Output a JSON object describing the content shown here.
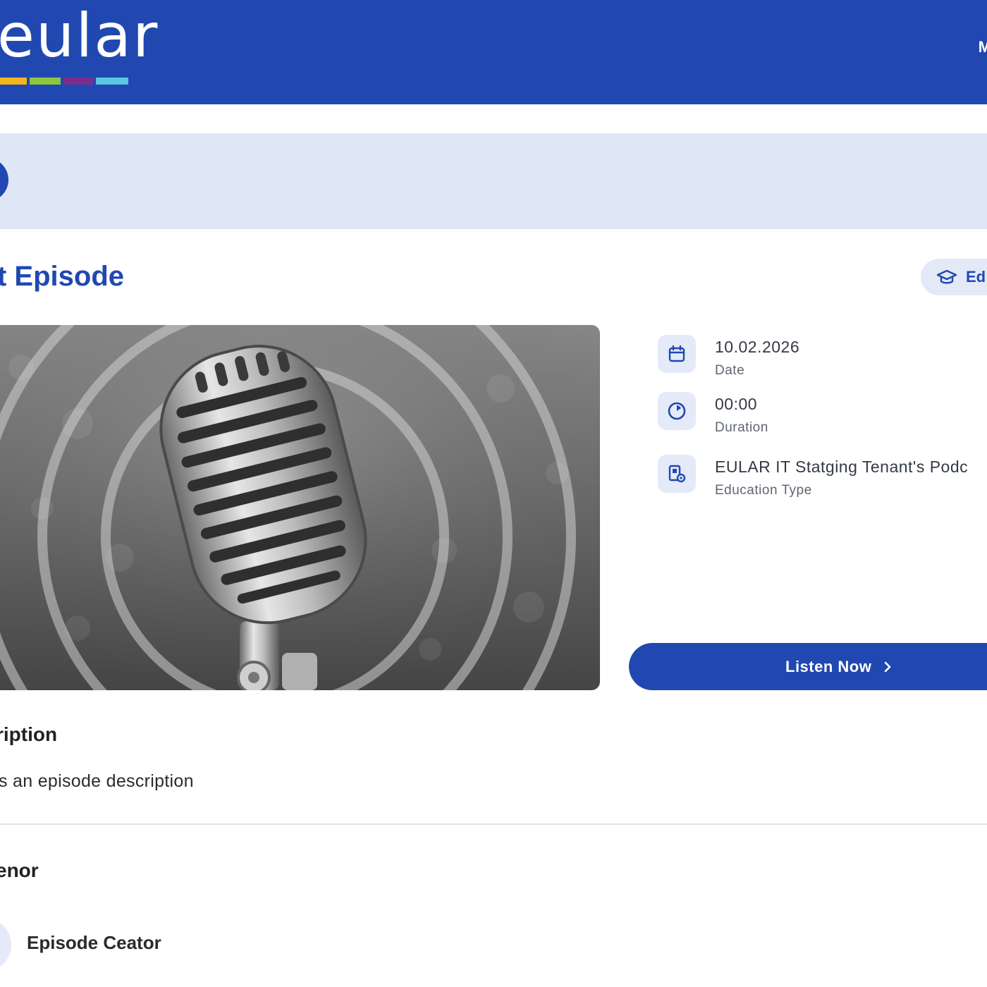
{
  "header": {
    "logo_text": "eular",
    "menu_text": "M",
    "logo_colors": [
      "#f3b51c",
      "#8cc63f",
      "#7b2d8e",
      "#5bc7e0"
    ]
  },
  "colors": {
    "brand": "#2148b1",
    "banner": "#dfe6f6",
    "icon_bg": "#e4eaf8"
  },
  "page": {
    "title": "t Episode",
    "education_pill": "Ed"
  },
  "meta": [
    {
      "icon": "calendar-icon",
      "value": "10.02.2026",
      "label": "Date"
    },
    {
      "icon": "clock-icon",
      "value": "00:00",
      "label": "Duration"
    },
    {
      "icon": "education-type-icon",
      "value": "EULAR IT Statging Tenant's Podc",
      "label": "Education Type"
    }
  ],
  "listen_button": {
    "label": "Listen Now"
  },
  "description": {
    "heading": "ription",
    "text": "s an episode description"
  },
  "convenor": {
    "heading": "enor",
    "name": "Episode Ceator"
  }
}
